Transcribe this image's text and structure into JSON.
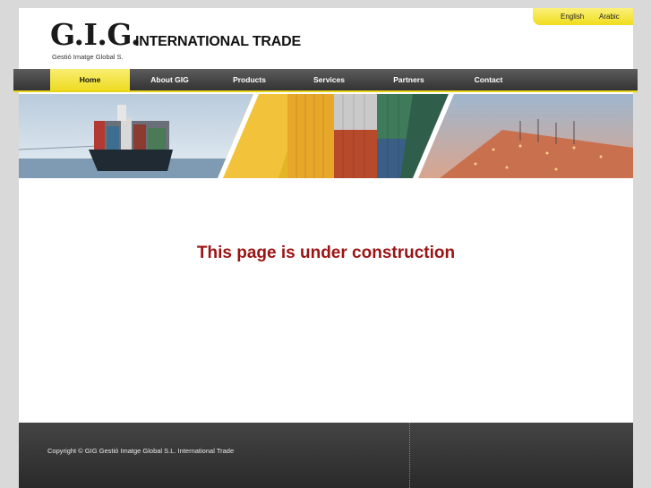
{
  "language": {
    "english": "English",
    "arabic": "Arabic"
  },
  "logo": {
    "mark": "G.I.G.",
    "subtitle": "Gestió Imatge Global S.",
    "title": "INTERNATIONAL TRADE"
  },
  "nav": {
    "items": [
      {
        "label": "Home"
      },
      {
        "label": "About GIG"
      },
      {
        "label": "Products"
      },
      {
        "label": "Services"
      },
      {
        "label": "Partners"
      },
      {
        "label": "Contact"
      }
    ]
  },
  "main": {
    "notice": "This page is under construction"
  },
  "footer": {
    "copyright": "Copyright © GIG Gestió Imatge Global S.L. International Trade"
  },
  "colors": {
    "accent": "#eedb22",
    "notice": "#9a1414",
    "nav": "#3f3f3f"
  }
}
